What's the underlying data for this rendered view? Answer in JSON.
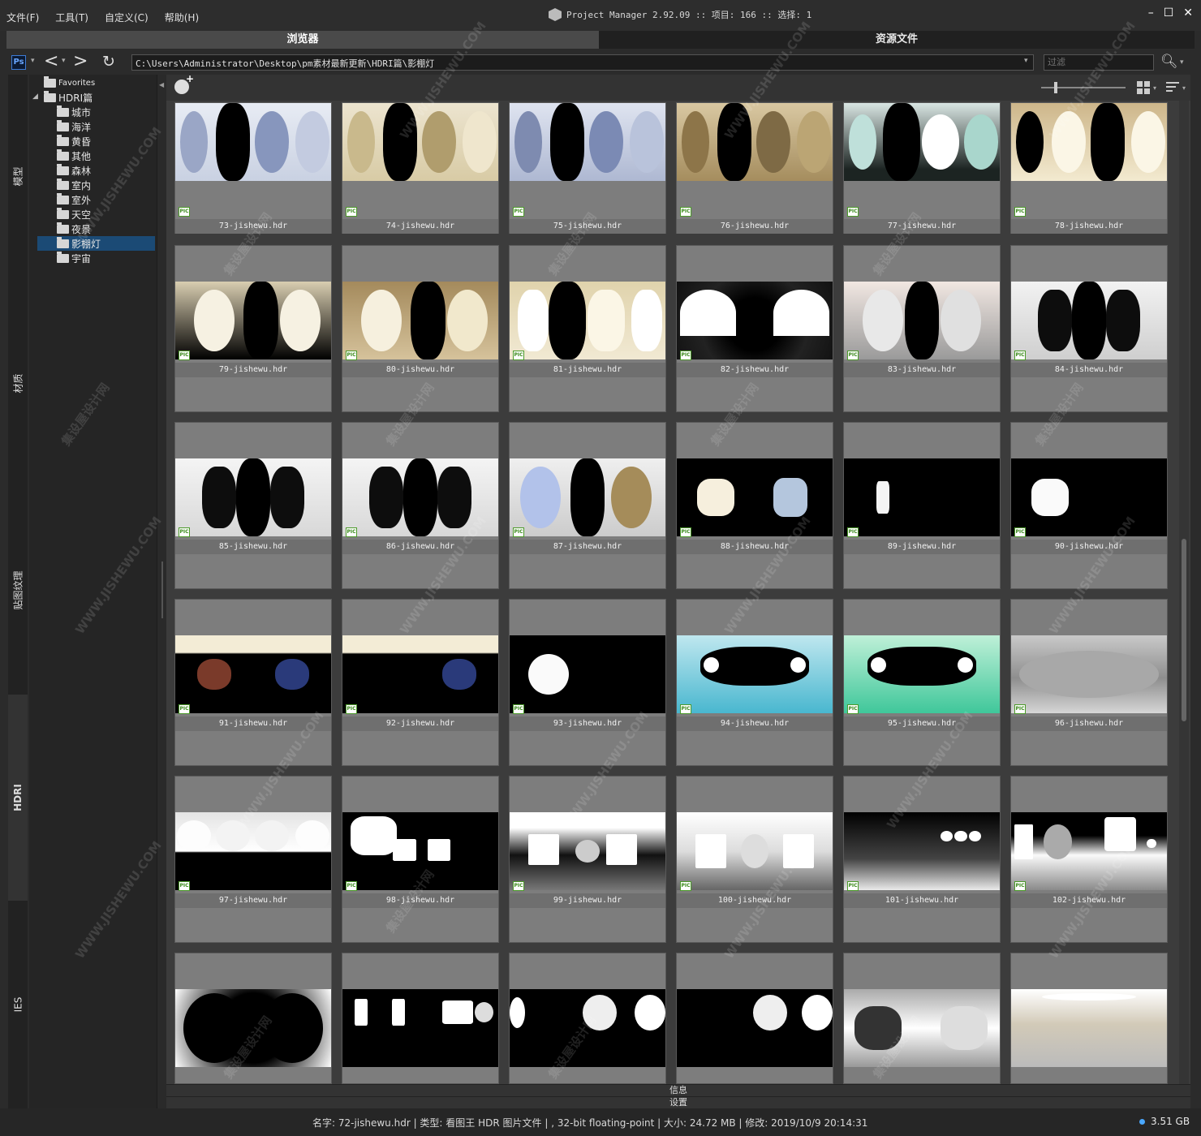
{
  "menu": [
    "文件(F)",
    "工具(T)",
    "自定义(C)",
    "帮助(H)"
  ],
  "title": "Project Manager 2.92.09  :: 项目: 166  :: 选择: 1",
  "window_controls": {
    "minimize": "–",
    "maximize": "☐",
    "close": "✕"
  },
  "tabs": {
    "browser": "浏览器",
    "assets": "资源文件"
  },
  "address": {
    "ps_label": "Ps",
    "path": "C:\\Users\\Administrator\\Desktop\\pm素材最新更新\\HDRI篇\\影棚灯",
    "filter_placeholder": "过滤"
  },
  "side_tabs": [
    "模型",
    "材质",
    "贴图纹理",
    "HDRI",
    "IES"
  ],
  "tree": {
    "favorites": "Favorites",
    "root": "HDRI篇",
    "folders": [
      "城市",
      "海洋",
      "黄昏",
      "其他",
      "森林",
      "室内",
      "室外",
      "天空",
      "夜景",
      "影棚灯",
      "宇宙"
    ],
    "selected": "影棚灯"
  },
  "files": [
    "73-jishewu.hdr",
    "74-jishewu.hdr",
    "75-jishewu.hdr",
    "76-jishewu.hdr",
    "77-jishewu.hdr",
    "78-jishewu.hdr",
    "79-jishewu.hdr",
    "80-jishewu.hdr",
    "81-jishewu.hdr",
    "82-jishewu.hdr",
    "83-jishewu.hdr",
    "84-jishewu.hdr",
    "85-jishewu.hdr",
    "86-jishewu.hdr",
    "87-jishewu.hdr",
    "88-jishewu.hdr",
    "89-jishewu.hdr",
    "90-jishewu.hdr",
    "91-jishewu.hdr",
    "92-jishewu.hdr",
    "93-jishewu.hdr",
    "94-jishewu.hdr",
    "95-jishewu.hdr",
    "96-jishewu.hdr",
    "97-jishewu.hdr",
    "98-jishewu.hdr",
    "99-jishewu.hdr",
    "100-jishewu.hdr",
    "101-jishewu.hdr",
    "102-jishewu.hdr"
  ],
  "file_badge": "PIC",
  "panels": {
    "info": "信息",
    "settings": "设置"
  },
  "status": {
    "text": "名字: 72-jishewu.hdr | 类型: 看图王 HDR 图片文件 | , 32-bit floating-point | 大小: 24.72 MB | 修改: 2019/10/9 20:14:31",
    "disk": "3.51 GB"
  },
  "watermark": {
    "text1": "集设屋设计网",
    "text2": "WWW.JISHEWU.COM"
  },
  "colors": {
    "accent": "#1b4a75",
    "disk_dot": "#4aa8ff"
  }
}
